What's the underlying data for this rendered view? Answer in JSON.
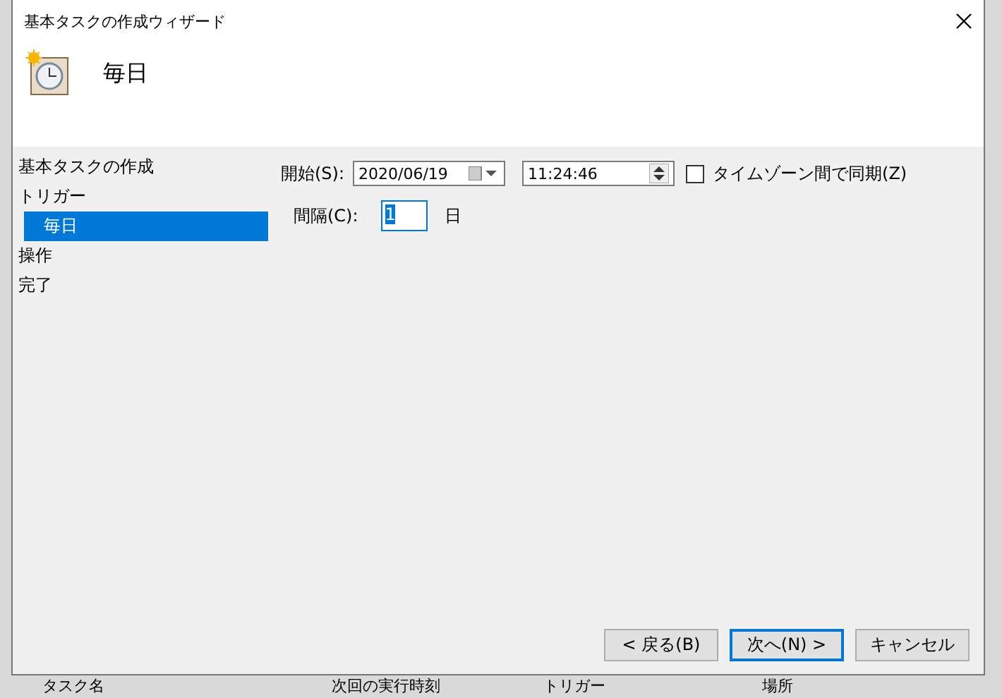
{
  "window": {
    "title": "基本タスクの作成ウィザード",
    "heading": "毎日"
  },
  "nav": [
    {
      "label": "基本タスクの作成",
      "selected": false
    },
    {
      "label": "トリガー",
      "selected": false,
      "children": [
        {
          "label": "毎日",
          "selected": true
        }
      ]
    },
    {
      "label": "操作",
      "selected": false
    },
    {
      "label": "完了",
      "selected": false
    }
  ],
  "start": {
    "label": "開始(S):",
    "date": "2020/06/19",
    "time": "11:24:46",
    "sync_label": "タイムゾーン間で同期(Z)",
    "sync_checked": false
  },
  "interval": {
    "label": "間隔(C):",
    "value": "1",
    "unit": "日"
  },
  "buttons": [
    {
      "label": "< 戻る(B)",
      "default": false
    },
    {
      "label": "次へ(N) >",
      "default": true
    },
    {
      "label": "キャンセル",
      "default": false
    }
  ],
  "background_table": {
    "columns": [
      "タスク名",
      "次回の実行時刻",
      "トリガー",
      "場所"
    ]
  }
}
